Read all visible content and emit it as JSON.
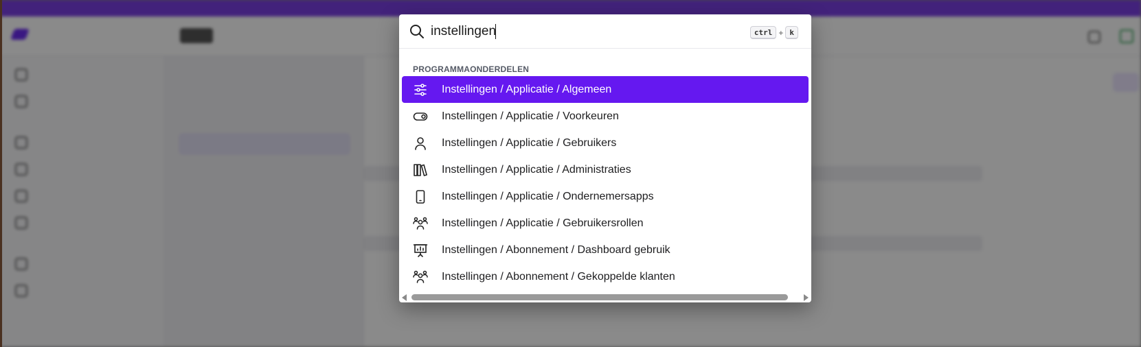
{
  "search": {
    "value": "instellingen",
    "shortcut_key1": "ctrl",
    "shortcut_plus": "+",
    "shortcut_key2": "k"
  },
  "section_label": "PROGRAMMAONDERDELEN",
  "results": [
    {
      "label": "Instellingen / Applicatie / Algemeen",
      "icon": "sliders-icon",
      "active": true
    },
    {
      "label": "Instellingen / Applicatie / Voorkeuren",
      "icon": "toggle-icon",
      "active": false
    },
    {
      "label": "Instellingen / Applicatie / Gebruikers",
      "icon": "user-icon",
      "active": false
    },
    {
      "label": "Instellingen / Applicatie / Administraties",
      "icon": "books-icon",
      "active": false
    },
    {
      "label": "Instellingen / Applicatie / Ondernemersapps",
      "icon": "smartphone-icon",
      "active": false
    },
    {
      "label": "Instellingen / Applicatie / Gebruikersrollen",
      "icon": "users-group-icon",
      "active": false
    },
    {
      "label": "Instellingen / Abonnement / Dashboard gebruik",
      "icon": "presentation-chart-icon",
      "active": false
    },
    {
      "label": "Instellingen / Abonnement / Gekoppelde klanten",
      "icon": "users-group-icon",
      "active": false
    }
  ],
  "colors": {
    "accent": "#6518f0",
    "overlay": "#000000",
    "banner": "#7b3fe4"
  }
}
